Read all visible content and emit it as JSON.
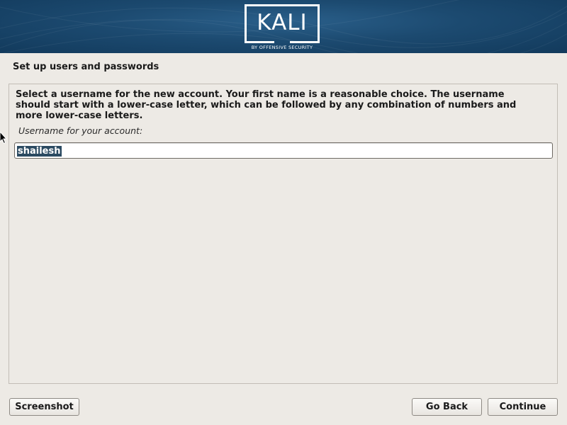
{
  "banner": {
    "logo_text": "KALI",
    "logo_subtitle": "BY OFFENSIVE SECURITY"
  },
  "page": {
    "title": "Set up users and passwords",
    "description": "Select a username for the new account. Your first name is a reasonable choice. The username should start with a lower-case letter, which can be followed by any combination of numbers and more lower-case letters.",
    "field_label": "Username for your account:",
    "username_value": "shailesh"
  },
  "buttons": {
    "screenshot": "Screenshot",
    "go_back": "Go Back",
    "continue": "Continue"
  },
  "colors": {
    "banner": "#1c4a70",
    "background": "#edeae5",
    "selection": "#2b4a61"
  }
}
